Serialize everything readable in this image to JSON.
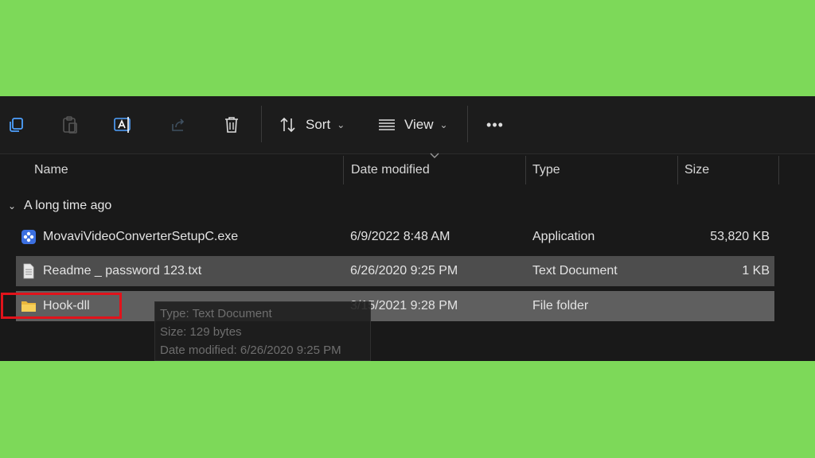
{
  "toolbar": {
    "copy_icon": "copy-icon",
    "paste_icon": "paste-icon",
    "rename_icon": "rename-icon",
    "share_icon": "share-icon",
    "delete_icon": "trash-icon",
    "sort_label": "Sort",
    "view_label": "View",
    "more_label": "•••"
  },
  "columns": {
    "name": "Name",
    "date": "Date modified",
    "type": "Type",
    "size": "Size"
  },
  "group": {
    "label": "A long time ago"
  },
  "files": [
    {
      "name": "MovaviVideoConverterSetupC.exe",
      "date": "6/9/2022 8:48 AM",
      "type": "Application",
      "size": "53,820 KB",
      "icon": "app-installer-icon"
    },
    {
      "name": "Readme _ password 123.txt",
      "date": "6/26/2020 9:25 PM",
      "type": "Text Document",
      "size": "1 KB",
      "icon": "text-file-icon",
      "selected": true
    },
    {
      "name": "Hook-dll",
      "date": "3/15/2021 9:28 PM",
      "type": "File folder",
      "size": "",
      "icon": "folder-icon",
      "hovered": true
    }
  ],
  "tooltip": {
    "type_line": "Type: Text Document",
    "size_line": "Size: 129 bytes",
    "date_line": "Date modified: 6/26/2020 9:25 PM"
  },
  "colors": {
    "background": "#7dd959",
    "explorer_bg": "#191919",
    "selected_row": "#4d4d4d",
    "hover_row": "#5f5f5f",
    "highlight_box": "#e1131b"
  }
}
